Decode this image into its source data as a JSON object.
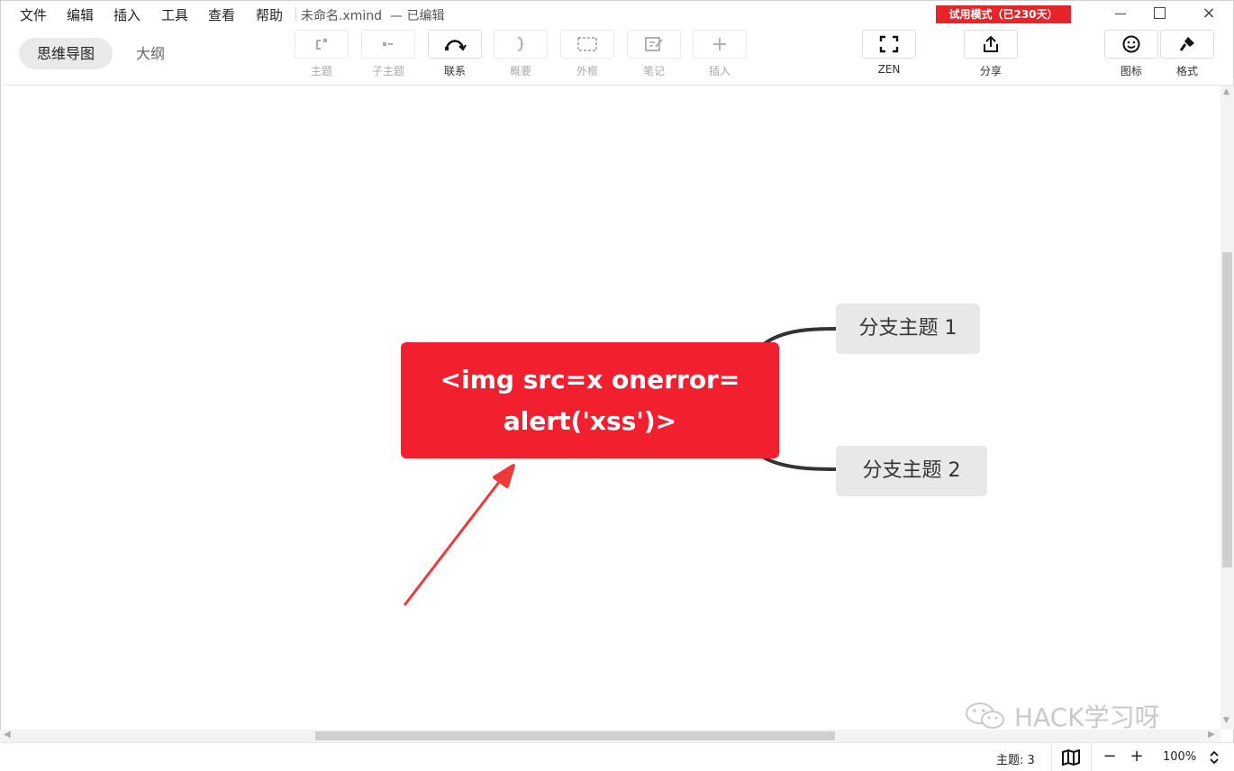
{
  "menu": {
    "items": [
      "文件",
      "编辑",
      "插入",
      "工具",
      "查看",
      "帮助"
    ],
    "doc_title": "未命名.xmind",
    "doc_status": "— 已编辑",
    "trial_badge": "试用模式（已230天）"
  },
  "window_controls": {
    "minimize": "minimize-icon",
    "maximize": "maximize-icon",
    "close": "×"
  },
  "view_tabs": {
    "mindmap": "思维导图",
    "outline": "大纲"
  },
  "toolbar": {
    "topic": "主题",
    "subtopic": "子主题",
    "relationship": "联系",
    "summary": "概要",
    "boundary": "外框",
    "note": "笔记",
    "insert": "插入",
    "zen": "ZEN",
    "share": "分享",
    "icons": "图标",
    "format": "格式"
  },
  "canvas": {
    "central_topic_line1": "<img src=x onerror=",
    "central_topic_line2": "alert('xss')>",
    "branch_1": "分支主题 1",
    "branch_2": "分支主题 2",
    "central_color": "#f21f2f",
    "annotation_arrow_color": "#ee3a3a"
  },
  "watermark": {
    "text": "HACK学习呀",
    "icon": "wechat-icon"
  },
  "statusbar": {
    "topic_count": "主题: 3",
    "zoom_out": "−",
    "zoom_in": "+",
    "zoom_level": "100%"
  }
}
